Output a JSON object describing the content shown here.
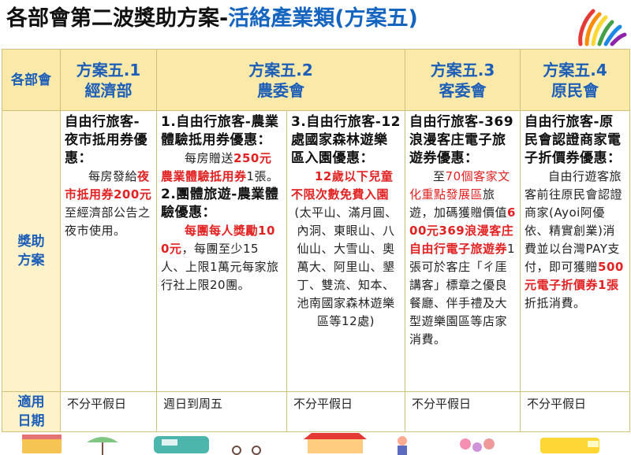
{
  "title_main": "各部會第二波獎助方案-",
  "title_accent": "活絡產業類(方案五)",
  "row_labels": {
    "dept": "各部會",
    "plan_line1": "獎助",
    "plan_line2": "方案",
    "date_line1": "適用",
    "date_line2": "日期"
  },
  "headers": [
    {
      "line1": "方案五.1",
      "line2": "經濟部"
    },
    {
      "line1": "方案五.2",
      "line2": "農委會"
    },
    {
      "line1": "方案五.3",
      "line2": "客委會"
    },
    {
      "line1": "方案五.4",
      "line2": "原民會"
    }
  ],
  "c1": {
    "heading": "自由行旅客-夜市抵用券優惠：",
    "p1": "每房發給",
    "red": "夜市抵用券200元",
    "p2": "至經濟部公告之夜市使用。"
  },
  "c2": {
    "h1": "1.自由行旅客-農業體驗抵用券優惠：",
    "p1": "每房贈送",
    "red1": "250元農業體驗抵用券",
    "p1b": "1張。",
    "h2": "2.團體旅遊-農業體驗優惠：",
    "red2": "每團每人獎勵100元",
    "p2": "，每團至少15人、上限1萬元每家旅行社上限20團。"
  },
  "c3": {
    "heading": "3.自由行旅客-12處國家森林遊樂區入園優惠：",
    "red": "12歲以下兒童不限次數免費入園",
    "p": "(太平山、滿月圓、內洞、東眼山、八仙山、大雪山、奧萬大、阿里山、墾丁、雙流、知本、池南國家森林遊樂區等12處)"
  },
  "c4": {
    "heading": "自由行旅客-369浪漫客庄電子旅遊券優惠：",
    "p1": "至",
    "red1": "70個客家文化重點發展區",
    "p2": "旅遊，加碼獲贈價值",
    "red2": "600元369浪漫客庄自由行電子旅遊券",
    "p3": "1張可於客庄「ㄔ厓講客」標章之優良餐廳、伴手禮及大型遊樂園區等店家消費。"
  },
  "c5": {
    "heading": "自由行旅客-原民會認證商家電子折價券優惠：",
    "p1": "自由行遊客旅客前往原民會認證商家(Ayoi阿優依、精實創業)消費並以台灣PAY支付，即可獲贈",
    "red": "500元電子折價券1張",
    "p2": "折抵消費。"
  },
  "dates": [
    "不分平假日",
    "週日到周五",
    "不分平假日",
    "不分平假日",
    "不分平假日"
  ],
  "colors": {
    "accent_blue": "#1d5fb8",
    "header_bg": "#fbe9a9",
    "highlight_red": "#e22222",
    "border": "#cfc07a"
  }
}
